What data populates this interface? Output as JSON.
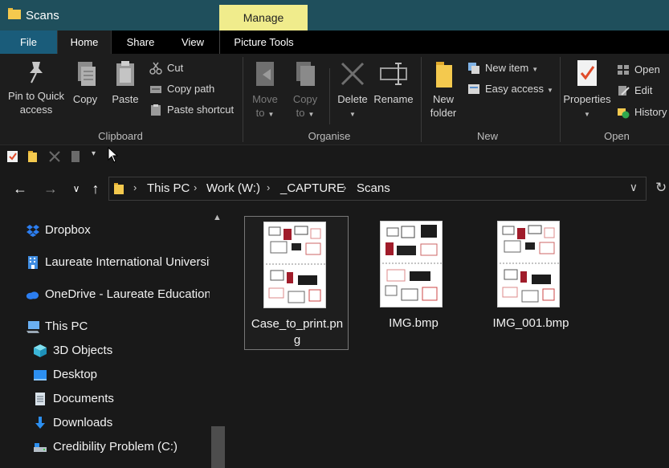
{
  "window": {
    "title": "Scans"
  },
  "context_tab": {
    "label": "Manage"
  },
  "tabs": {
    "file": "File",
    "home": "Home",
    "share": "Share",
    "view": "View",
    "picture_tools": "Picture Tools"
  },
  "ribbon": {
    "clipboard": {
      "label": "Clipboard",
      "pin": "Pin to Quick access",
      "pin_line1": "Pin to Quick",
      "pin_line2": "access",
      "copy": "Copy",
      "paste": "Paste",
      "cut": "Cut",
      "copy_path": "Copy path",
      "paste_shortcut": "Paste shortcut"
    },
    "organise": {
      "label": "Organise",
      "move_to_1": "Move",
      "move_to_2": "to",
      "copy_to_1": "Copy",
      "copy_to_2": "to",
      "delete": "Delete",
      "rename": "Rename"
    },
    "new": {
      "label": "New",
      "new_folder_1": "New",
      "new_folder_2": "folder",
      "new_item": "New item",
      "easy_access": "Easy access"
    },
    "open": {
      "label": "Open",
      "properties": "Properties",
      "open": "Open",
      "edit": "Edit",
      "history": "History"
    }
  },
  "address": {
    "crumbs": [
      "This PC",
      "Work (W:)",
      "_CAPTURE",
      "Scans"
    ]
  },
  "nav": {
    "items": [
      {
        "label": "Dropbox",
        "icon": "dropbox-icon"
      },
      {
        "label": "Laureate International Universit",
        "icon": "building-icon"
      },
      {
        "label": "OneDrive - Laureate Education",
        "icon": "cloud-icon"
      },
      {
        "label": "This PC",
        "icon": "computer-icon"
      },
      {
        "label": "3D Objects",
        "icon": "cube-icon"
      },
      {
        "label": "Desktop",
        "icon": "desktop-icon"
      },
      {
        "label": "Documents",
        "icon": "document-icon"
      },
      {
        "label": "Downloads",
        "icon": "download-icon"
      },
      {
        "label": "Credibility Problem (C:)",
        "icon": "drive-icon"
      }
    ]
  },
  "files": [
    {
      "name_line1": "Case_to_print.pn",
      "name_line2": "g"
    },
    {
      "name_line1": "IMG.bmp",
      "name_line2": ""
    },
    {
      "name_line1": "IMG_001.bmp",
      "name_line2": ""
    }
  ],
  "colors": {
    "titlebar": "#1f4f5c",
    "manage_tab": "#f0ec8c",
    "file_tab": "#1a5c7a",
    "background": "#191919"
  }
}
